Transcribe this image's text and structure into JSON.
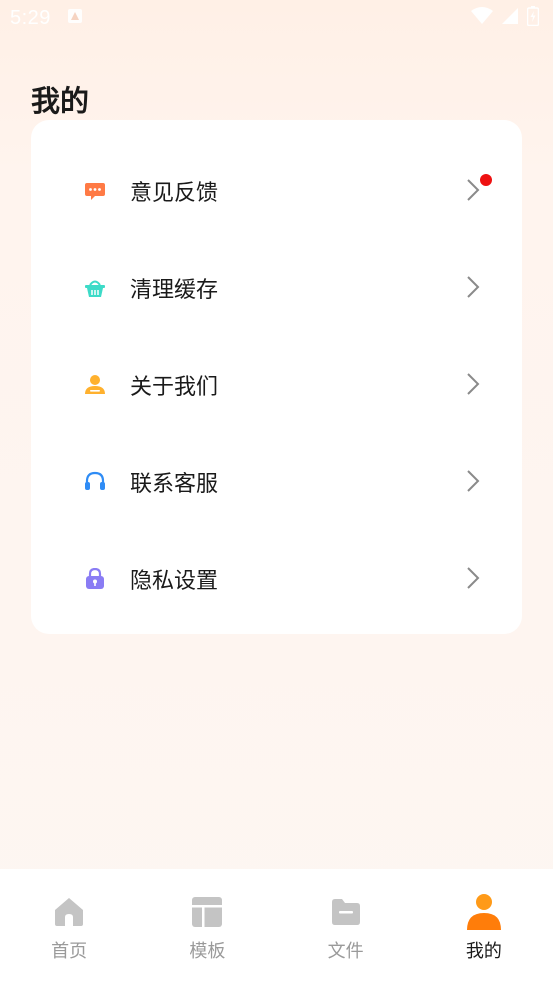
{
  "status_bar": {
    "time": "5:29"
  },
  "page": {
    "title": "我的"
  },
  "menu": {
    "items": [
      {
        "label": "意见反馈",
        "icon": "feedback-icon",
        "badge": true,
        "color": "#ff7a45"
      },
      {
        "label": "清理缓存",
        "icon": "clean-cache-icon",
        "badge": false,
        "color": "#3ddbc8"
      },
      {
        "label": "关于我们",
        "icon": "about-user-icon",
        "badge": false,
        "color": "#ffb12e"
      },
      {
        "label": "联系客服",
        "icon": "headset-icon",
        "badge": false,
        "color": "#2f8cf5"
      },
      {
        "label": "隐私设置",
        "icon": "lock-icon",
        "badge": false,
        "color": "#8a7cf4"
      }
    ]
  },
  "bottom_nav": {
    "items": [
      {
        "label": "首页",
        "icon": "home-icon",
        "active": false
      },
      {
        "label": "模板",
        "icon": "template-icon",
        "active": false
      },
      {
        "label": "文件",
        "icon": "folder-icon",
        "active": false
      },
      {
        "label": "我的",
        "icon": "user-icon",
        "active": true
      }
    ]
  },
  "colors": {
    "accent": "#ff7d0a",
    "inactive": "#c4c4c4",
    "badge": "#ee1111"
  }
}
